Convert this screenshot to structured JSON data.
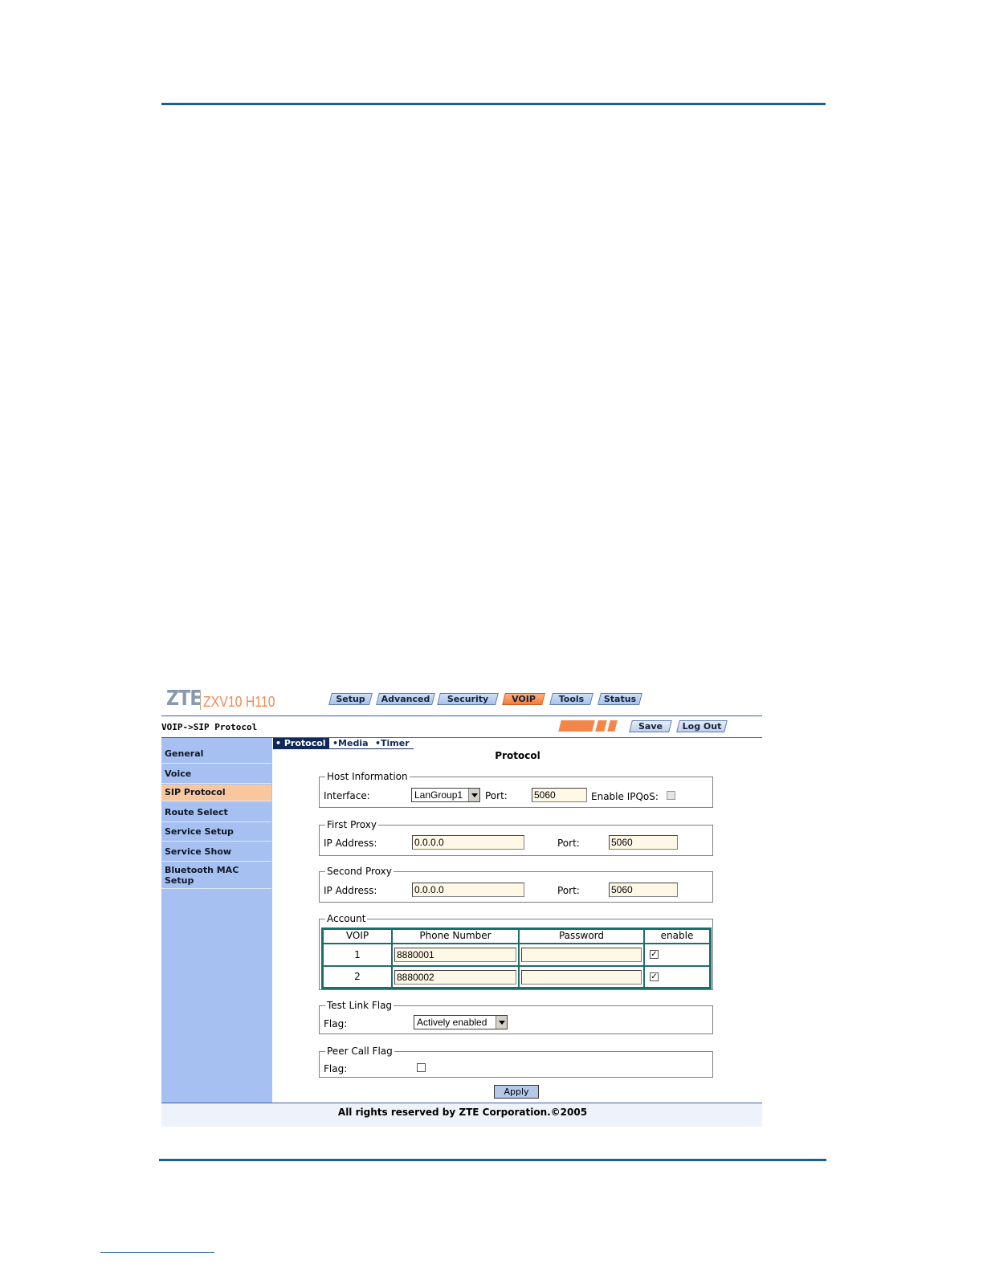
{
  "header": {
    "logo_brand": "ZTE",
    "logo_model": "ZXV10 H110",
    "tabs": [
      {
        "label": "Setup",
        "active": false
      },
      {
        "label": "Advanced",
        "active": false
      },
      {
        "label": "Security",
        "active": false
      },
      {
        "label": "VOIP",
        "active": true
      },
      {
        "label": "Tools",
        "active": false
      },
      {
        "label": "Status",
        "active": false
      }
    ]
  },
  "subbar": {
    "breadcrumb": "VOIP->SIP Protocol",
    "save_label": "Save",
    "logout_label": "Log Out"
  },
  "sidebar": {
    "items": [
      {
        "label": "General",
        "active": false
      },
      {
        "label": "Voice",
        "active": false
      },
      {
        "label": "SIP Protocol",
        "active": true
      },
      {
        "label": "Route Select",
        "active": false
      },
      {
        "label": "Service Setup",
        "active": false
      },
      {
        "label": "Service Show",
        "active": false
      },
      {
        "label": "Bluetooth MAC Setup",
        "active": false
      }
    ]
  },
  "subtabs": [
    {
      "label": "• Protocol",
      "active": true
    },
    {
      "label": "•Media",
      "active": false
    },
    {
      "label": "•Timer",
      "active": false
    }
  ],
  "page_title": "Protocol",
  "host_info": {
    "legend": "Host Information",
    "interface_label": "Interface:",
    "interface_value": "LanGroup1",
    "port_label": "Port:",
    "port_value": "5060",
    "ipqos_label": "Enable IPQoS:",
    "ipqos_checked": false
  },
  "first_proxy": {
    "legend": "First Proxy",
    "ip_label": "IP Address:",
    "ip_value": "0.0.0.0",
    "port_label": "Port:",
    "port_value": "5060"
  },
  "second_proxy": {
    "legend": "Second Proxy",
    "ip_label": "IP Address:",
    "ip_value": "0.0.0.0",
    "port_label": "Port:",
    "port_value": "5060"
  },
  "account": {
    "legend": "Account",
    "columns": [
      "VOIP",
      "Phone Number",
      "Password",
      "enable"
    ],
    "rows": [
      {
        "voip": "1",
        "phone": "8880001",
        "password": "",
        "enabled": true
      },
      {
        "voip": "2",
        "phone": "8880002",
        "password": "",
        "enabled": true
      }
    ]
  },
  "test_link": {
    "legend": "Test Link Flag",
    "flag_label": "Flag:",
    "flag_value": "Actively enabled"
  },
  "peer_call": {
    "legend": "Peer Call Flag",
    "flag_label": "Flag:",
    "flag_checked": false
  },
  "apply_label": "Apply",
  "footer": {
    "copyright": "All rights reserved by ZTE Corporation.©2005"
  }
}
